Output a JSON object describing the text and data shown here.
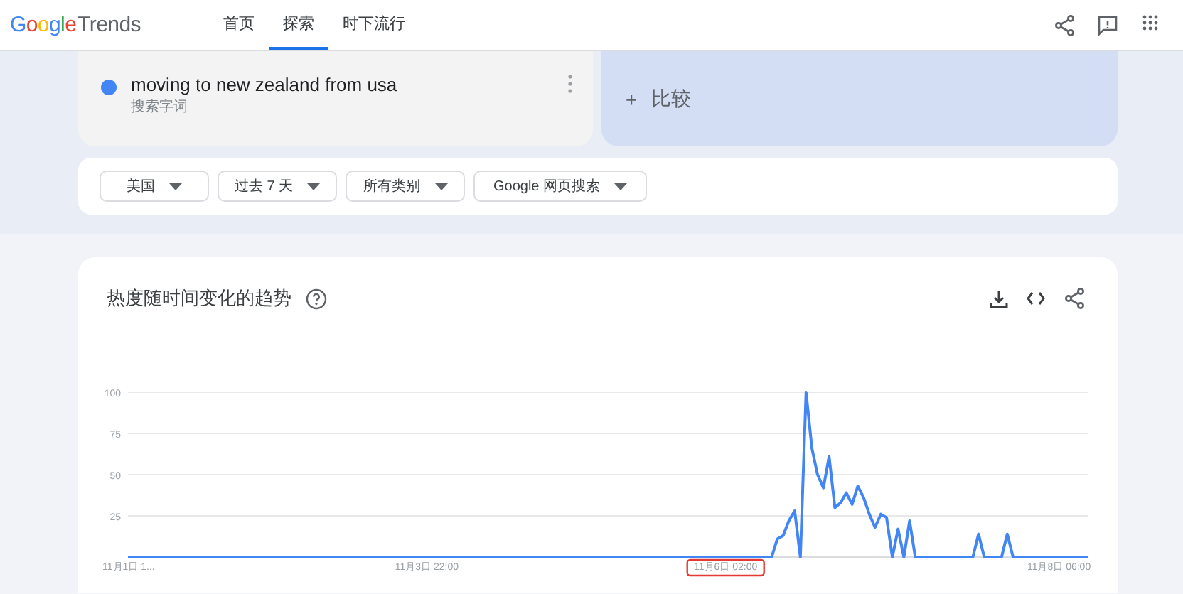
{
  "header": {
    "logo": {
      "brand": "Google",
      "product": "Trends"
    },
    "tabs": [
      {
        "label": "首页",
        "selected": false
      },
      {
        "label": "探索",
        "selected": true
      },
      {
        "label": "时下流行",
        "selected": false
      }
    ]
  },
  "search_term": {
    "term": "moving to new zealand from usa",
    "subtitle": "搜索字词",
    "color": "#4285f4"
  },
  "compare": {
    "icon": "+",
    "label": "比较"
  },
  "filters": [
    "美国",
    "过去 7 天",
    "所有类别",
    "Google 网页搜索"
  ],
  "chart_card": {
    "title": "热度随时间变化的趋势",
    "chart_data": {
      "type": "line",
      "grid": true,
      "ylim": [
        0,
        100
      ],
      "yticks": [
        25,
        50,
        75,
        100
      ],
      "categories": [
        "11月1日 1...",
        null,
        null,
        null,
        null,
        null,
        null,
        null,
        null,
        null,
        null,
        null,
        null,
        null,
        null,
        null,
        null,
        null,
        null,
        null,
        null,
        null,
        null,
        null,
        null,
        null,
        null,
        null,
        null,
        null,
        null,
        null,
        null,
        null,
        null,
        null,
        null,
        null,
        null,
        null,
        null,
        null,
        null,
        null,
        null,
        null,
        null,
        null,
        null,
        null,
        null,
        null,
        "11月3日 22:00",
        null,
        null,
        null,
        null,
        null,
        null,
        null,
        null,
        null,
        null,
        null,
        null,
        null,
        null,
        null,
        null,
        null,
        null,
        null,
        null,
        null,
        null,
        null,
        null,
        null,
        null,
        null,
        null,
        null,
        null,
        null,
        null,
        null,
        null,
        null,
        null,
        null,
        null,
        null,
        null,
        null,
        null,
        null,
        null,
        null,
        null,
        null,
        null,
        null,
        null,
        null,
        "11月6日 02:00",
        null,
        null,
        null,
        null,
        null,
        null,
        null,
        null,
        null,
        null,
        null,
        null,
        null,
        null,
        null,
        null,
        null,
        null,
        null,
        null,
        null,
        null,
        null,
        null,
        null,
        null,
        null,
        null,
        null,
        null,
        null,
        null,
        null,
        null,
        null,
        null,
        null,
        null,
        null,
        null,
        null,
        null,
        null,
        null,
        null,
        null,
        null,
        null,
        null,
        null,
        null,
        null,
        null,
        null,
        null,
        null,
        null,
        "11月8日 06:00",
        null,
        null,
        null,
        null,
        null
      ],
      "annotations": [
        {
          "x": "11月6日 02:00"
        }
      ],
      "series": [
        {
          "color": "#4285f4",
          "values": [
            0,
            0,
            0,
            0,
            0,
            0,
            0,
            0,
            0,
            0,
            0,
            0,
            0,
            0,
            0,
            0,
            0,
            0,
            0,
            0,
            0,
            0,
            0,
            0,
            0,
            0,
            0,
            0,
            0,
            0,
            0,
            0,
            0,
            0,
            0,
            0,
            0,
            0,
            0,
            0,
            0,
            0,
            0,
            0,
            0,
            0,
            0,
            0,
            0,
            0,
            0,
            0,
            0,
            0,
            0,
            0,
            0,
            0,
            0,
            0,
            0,
            0,
            0,
            0,
            0,
            0,
            0,
            0,
            0,
            0,
            0,
            0,
            0,
            0,
            0,
            0,
            0,
            0,
            0,
            0,
            0,
            0,
            0,
            0,
            0,
            0,
            0,
            0,
            0,
            0,
            0,
            0,
            0,
            0,
            0,
            0,
            0,
            0,
            0,
            0,
            0,
            0,
            0,
            0,
            0,
            0,
            0,
            0,
            0,
            0,
            0,
            0,
            0,
            11,
            13,
            22,
            28,
            0,
            100,
            66,
            50,
            42,
            61,
            30,
            33,
            39,
            32,
            43,
            36,
            26,
            18,
            26,
            24,
            0,
            17,
            0,
            22,
            0,
            0,
            0,
            0,
            0,
            0,
            0,
            0,
            0,
            0,
            0,
            14,
            0,
            0,
            0,
            0,
            14,
            0,
            0,
            0,
            0,
            0,
            0,
            0,
            0,
            0,
            0,
            0,
            0,
            0,
            0
          ]
        }
      ]
    }
  }
}
